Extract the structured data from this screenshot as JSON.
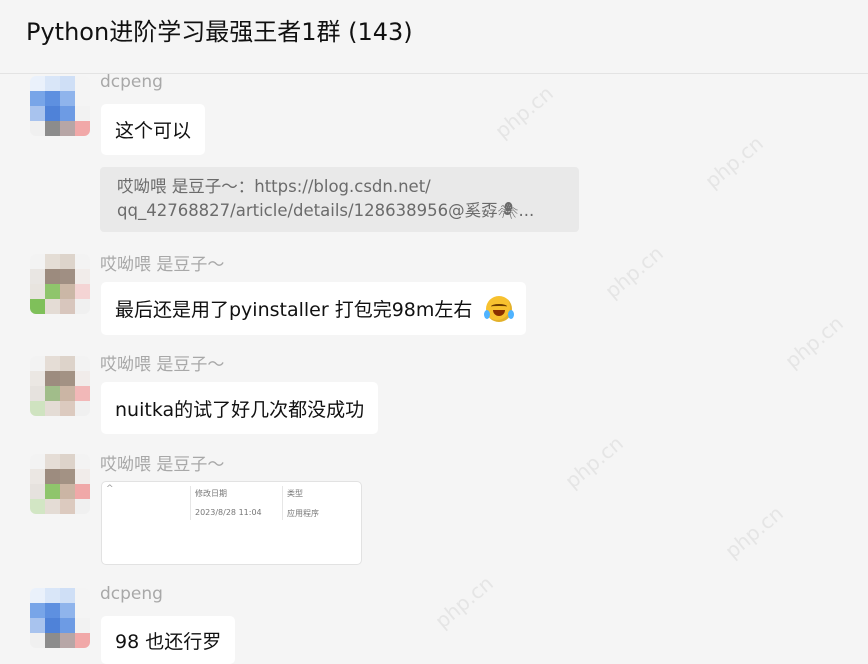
{
  "header": {
    "title": "Python进阶学习最强王者1群 (143)"
  },
  "messages": [
    {
      "sender": "dcpeng",
      "text": "这个可以"
    },
    {
      "quote_line1": "哎呦喂  是豆子～：https://blog.csdn.net/",
      "quote_line2": "qq_42768827/article/details/128638956@奚孬🕷..."
    },
    {
      "sender": "哎呦喂  是豆子～",
      "text": "最后还是用了pyinstaller  打包完98m左右",
      "emoji": "laughing-crying-emoji"
    },
    {
      "sender": "哎呦喂  是豆子～",
      "text": "nuitka的试了好几次都没成功"
    },
    {
      "sender": "哎呦喂  是豆子～",
      "image": {
        "col1": "修改日期",
        "col2": "类型",
        "date": "2023/8/28 11:04",
        "type": "应用程序"
      }
    },
    {
      "sender": "dcpeng",
      "text": "98 也还行罗"
    }
  ],
  "watermark": "php.cn",
  "colors": {
    "background": "#f5f5f5",
    "bubble": "#ffffff",
    "quote": "#e9e9e9",
    "name": "#a8a8a8"
  }
}
